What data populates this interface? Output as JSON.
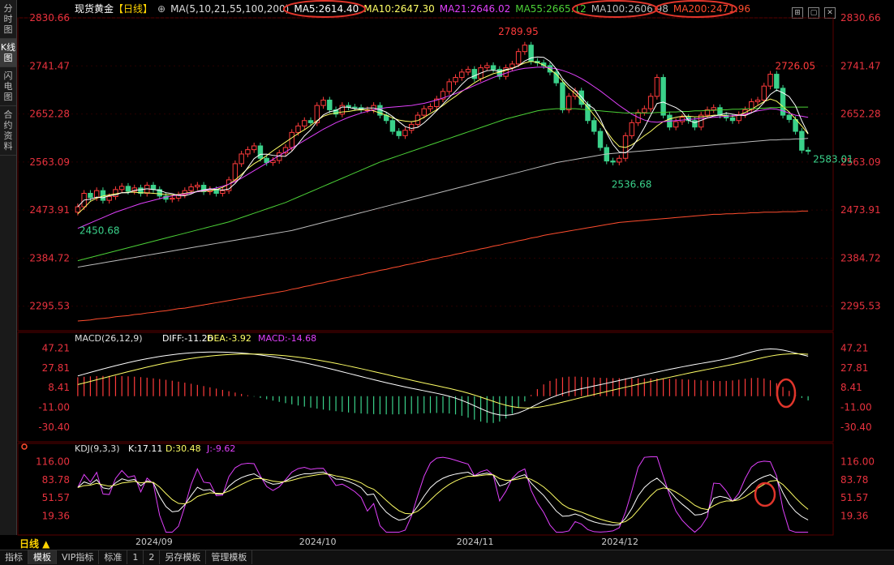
{
  "sidebar": {
    "tabs": [
      "分时图",
      "K线图",
      "闪电图",
      "合约资料"
    ],
    "active": 1
  },
  "header": {
    "symbol": "现货黄金",
    "period": "【日线】",
    "ma_label": "MA(5,10,21,55,100,200)",
    "ma5": "MA5:2614.40",
    "ma10": "MA10:2647.30",
    "ma21": "MA21:2646.02",
    "ma55": "MA55:2665.12",
    "ma100": "MA100:2606.98",
    "ma200": "MA200:2471.96"
  },
  "colors": {
    "up": "#ff3b3b",
    "down": "#3ad18a",
    "ma5": "#ffffff",
    "ma10": "#ffff66",
    "ma21": "#e040fb",
    "ma55": "#4cd137",
    "ma100": "#bbbbbb",
    "ma200": "#ff4d2e",
    "axis_text": "#e8323e",
    "annot": "#ff3b3b"
  },
  "chart_data": [
    {
      "type": "candlestick",
      "title": "现货黄金 日线",
      "ylim": [
        2250,
        2830.66
      ],
      "y_ticks": [
        2830.66,
        2741.47,
        2652.28,
        2563.09,
        2473.91,
        2384.72,
        2295.53
      ],
      "x_ticks": [
        "2024/09",
        "2024/10",
        "2024/11",
        "2024/12"
      ],
      "annotations": [
        {
          "label": "2789.95",
          "value": 2789.95
        },
        {
          "label": "2726.05",
          "value": 2726.05
        },
        {
          "label": "2536.68",
          "value": 2536.68
        },
        {
          "label": "2450.68",
          "value": 2450.68
        },
        {
          "label": "2583.01",
          "value": 2583.01
        }
      ],
      "closes": [
        2480,
        2505,
        2497,
        2510,
        2492,
        2499,
        2512,
        2518,
        2509,
        2515,
        2505,
        2520,
        2512,
        2500,
        2494,
        2496,
        2502,
        2510,
        2517,
        2520,
        2508,
        2512,
        2505,
        2510,
        2530,
        2560,
        2578,
        2586,
        2593,
        2570,
        2562,
        2566,
        2580,
        2590,
        2618,
        2630,
        2640,
        2636,
        2668,
        2678,
        2660,
        2652,
        2668,
        2665,
        2664,
        2660,
        2660,
        2668,
        2650,
        2640,
        2620,
        2612,
        2622,
        2633,
        2650,
        2662,
        2666,
        2680,
        2694,
        2712,
        2720,
        2730,
        2735,
        2718,
        2738,
        2742,
        2735,
        2722,
        2738,
        2745,
        2768,
        2780,
        2750,
        2747,
        2742,
        2730,
        2710,
        2660,
        2685,
        2695,
        2670,
        2640,
        2620,
        2590,
        2565,
        2563,
        2570,
        2612,
        2636,
        2655,
        2662,
        2685,
        2720,
        2650,
        2628,
        2638,
        2646,
        2640,
        2628,
        2650,
        2660,
        2664,
        2650,
        2645,
        2640,
        2651,
        2660,
        2675,
        2678,
        2704,
        2726,
        2700,
        2650,
        2642,
        2620,
        2585,
        2583
      ],
      "ma_lines": {
        "MA10": [
          2467,
          2478,
          2490,
          2496,
          2500,
          2502,
          2504,
          2506,
          2507,
          2507,
          2506,
          2506,
          2505,
          2504,
          2503,
          2502,
          2503,
          2505,
          2507,
          2508,
          2509,
          2510,
          2512,
          2516,
          2522,
          2530,
          2540,
          2551,
          2560,
          2567,
          2575,
          2584,
          2592,
          2600,
          2608,
          2616,
          2623,
          2631,
          2640,
          2648,
          2652,
          2654,
          2656,
          2657,
          2659,
          2660,
          2660,
          2658,
          2654,
          2650,
          2645,
          2641,
          2639,
          2638,
          2640,
          2646,
          2653,
          2660,
          2668,
          2677,
          2685,
          2694,
          2702,
          2710,
          2717,
          2722,
          2727,
          2730,
          2733,
          2737,
          2742,
          2747,
          2750,
          2748,
          2743,
          2735,
          2726,
          2713,
          2700,
          2690,
          2678,
          2665,
          2650,
          2636,
          2620,
          2604,
          2592,
          2590,
          2595,
          2603,
          2612,
          2620,
          2630,
          2638,
          2643,
          2646,
          2648,
          2648,
          2647,
          2647,
          2648,
          2650,
          2650,
          2649,
          2648,
          2650,
          2655,
          2661,
          2668,
          2675,
          2680,
          2676,
          2666,
          2656,
          2643,
          2630,
          2615
        ],
        "MA21": [
          2440,
          2445,
          2450,
          2455,
          2460,
          2465,
          2470,
          2474,
          2478,
          2482,
          2486,
          2489,
          2492,
          2495,
          2498,
          2500,
          2502,
          2504,
          2506,
          2508,
          2510,
          2512,
          2515,
          2518,
          2522,
          2527,
          2533,
          2540,
          2547,
          2554,
          2561,
          2568,
          2575,
          2582,
          2589,
          2596,
          2603,
          2610,
          2617,
          2624,
          2630,
          2636,
          2641,
          2646,
          2650,
          2654,
          2657,
          2660,
          2662,
          2664,
          2665,
          2666,
          2667,
          2668,
          2670,
          2672,
          2675,
          2678,
          2682,
          2686,
          2690,
          2695,
          2700,
          2705,
          2710,
          2715,
          2720,
          2724,
          2728,
          2732,
          2735,
          2737,
          2738,
          2739,
          2739,
          2738,
          2736,
          2733,
          2729,
          2724,
          2718,
          2711,
          2703,
          2695,
          2686,
          2677,
          2668,
          2660,
          2652,
          2646,
          2641,
          2638,
          2637,
          2638,
          2639,
          2640,
          2641,
          2642,
          2643,
          2644,
          2645,
          2646,
          2647,
          2648,
          2649,
          2650,
          2652,
          2655,
          2658,
          2660,
          2662,
          2661,
          2658,
          2654,
          2650,
          2648,
          2646
        ],
        "MA55": [
          2380,
          2383,
          2386,
          2389,
          2392,
          2395,
          2398,
          2401,
          2404,
          2407,
          2410,
          2413,
          2416,
          2419,
          2422,
          2425,
          2428,
          2431,
          2434,
          2437,
          2440,
          2443,
          2446,
          2449,
          2452,
          2456,
          2460,
          2464,
          2468,
          2472,
          2476,
          2480,
          2484,
          2488,
          2493,
          2498,
          2503,
          2508,
          2513,
          2518,
          2523,
          2528,
          2533,
          2538,
          2543,
          2548,
          2553,
          2558,
          2563,
          2567,
          2571,
          2575,
          2579,
          2583,
          2587,
          2591,
          2595,
          2599,
          2603,
          2607,
          2611,
          2615,
          2619,
          2623,
          2627,
          2631,
          2635,
          2639,
          2643,
          2646,
          2649,
          2652,
          2655,
          2658,
          2660,
          2661,
          2662,
          2662,
          2662,
          2662,
          2661,
          2660,
          2659,
          2658,
          2657,
          2656,
          2655,
          2654,
          2654,
          2654,
          2654,
          2654,
          2655,
          2655,
          2656,
          2656,
          2657,
          2657,
          2658,
          2658,
          2659,
          2659,
          2660,
          2660,
          2661,
          2661,
          2662,
          2662,
          2663,
          2663,
          2664,
          2664,
          2665,
          2665,
          2665,
          2665,
          2665
        ],
        "MA100": [
          2368,
          2370,
          2372,
          2374,
          2376,
          2378,
          2380,
          2382,
          2384,
          2386,
          2388,
          2390,
          2392,
          2394,
          2396,
          2398,
          2400,
          2402,
          2404,
          2406,
          2408,
          2410,
          2412,
          2414,
          2416,
          2418,
          2420,
          2422,
          2424,
          2426,
          2428,
          2430,
          2432,
          2434,
          2436,
          2439,
          2442,
          2445,
          2448,
          2451,
          2454,
          2457,
          2460,
          2463,
          2466,
          2469,
          2472,
          2475,
          2478,
          2481,
          2484,
          2487,
          2490,
          2493,
          2496,
          2499,
          2502,
          2505,
          2508,
          2511,
          2514,
          2517,
          2520,
          2523,
          2526,
          2529,
          2532,
          2535,
          2538,
          2541,
          2544,
          2547,
          2550,
          2553,
          2556,
          2559,
          2562,
          2564,
          2566,
          2568,
          2570,
          2572,
          2574,
          2576,
          2578,
          2579,
          2580,
          2581,
          2582,
          2583,
          2584,
          2585,
          2586,
          2587,
          2588,
          2589,
          2590,
          2591,
          2592,
          2593,
          2594,
          2595,
          2596,
          2597,
          2598,
          2599,
          2600,
          2601,
          2602,
          2603,
          2604,
          2604,
          2605,
          2605,
          2606,
          2606,
          2607
        ],
        "MA200": [
          2268,
          2269,
          2270,
          2272,
          2273,
          2274,
          2276,
          2277,
          2278,
          2280,
          2281,
          2283,
          2284,
          2286,
          2287,
          2289,
          2291,
          2292,
          2294,
          2296,
          2298,
          2300,
          2302,
          2304,
          2306,
          2308,
          2310,
          2312,
          2314,
          2316,
          2318,
          2320,
          2322,
          2324,
          2327,
          2329,
          2332,
          2334,
          2337,
          2339,
          2342,
          2344,
          2347,
          2349,
          2352,
          2354,
          2357,
          2359,
          2362,
          2364,
          2367,
          2369,
          2372,
          2374,
          2377,
          2379,
          2382,
          2384,
          2387,
          2389,
          2392,
          2394,
          2397,
          2399,
          2402,
          2404,
          2407,
          2409,
          2412,
          2414,
          2417,
          2419,
          2422,
          2424,
          2427,
          2429,
          2431,
          2433,
          2435,
          2437,
          2439,
          2441,
          2443,
          2445,
          2447,
          2449,
          2451,
          2452,
          2453,
          2454,
          2455,
          2456,
          2457,
          2458,
          2459,
          2460,
          2461,
          2462,
          2463,
          2464,
          2465,
          2466,
          2466,
          2467,
          2467,
          2468,
          2468,
          2469,
          2469,
          2470,
          2470,
          2470,
          2471,
          2471,
          2471,
          2472,
          2472
        ]
      }
    },
    {
      "type": "macd",
      "title": "MACD(26,12,9)",
      "ylim": [
        -45,
        55
      ],
      "y_ticks": [
        47.21,
        27.81,
        8.41,
        -11.0,
        -30.4
      ],
      "legend": {
        "diff": "DIFF:-11.26",
        "dea": "DEA:-3.92",
        "macd": "MACD:-14.68"
      }
    },
    {
      "type": "kdj",
      "title": "KDJ(9,3,3)",
      "ylim": [
        -15,
        130
      ],
      "y_ticks": [
        116.0,
        83.78,
        51.57,
        19.36
      ],
      "legend": {
        "k": "K:17.11",
        "d": "D:30.48",
        "j": "J:-9.62"
      }
    }
  ],
  "bottom": {
    "period_label": "日线 ▲",
    "tabs": [
      "指标",
      "模板",
      "VIP指标",
      "标准",
      "1",
      "2",
      "另存模板",
      "管理模板"
    ],
    "active": 1
  }
}
